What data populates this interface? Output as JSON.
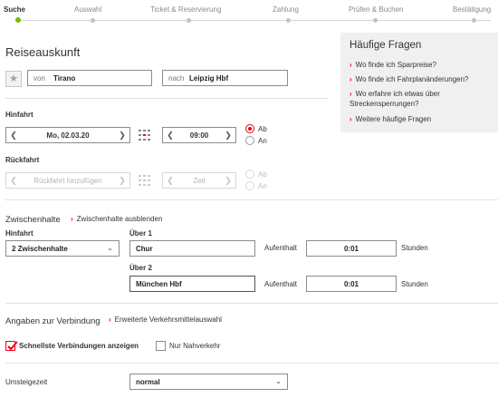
{
  "steps": [
    {
      "label": "Suche",
      "active": true
    },
    {
      "label": "Auswahl",
      "active": false
    },
    {
      "label": "Ticket & Reservierung",
      "active": false
    },
    {
      "label": "Zahlung",
      "active": false
    },
    {
      "label": "Prüfen & Buchen",
      "active": false
    },
    {
      "label": "Bestätigung",
      "active": false
    }
  ],
  "title": "Reiseauskunft",
  "route": {
    "from_label": "von",
    "from_value": "Tirano",
    "to_label": "nach",
    "to_value": "Leipzig Hbf"
  },
  "hinfahrt": {
    "heading": "Hinfahrt",
    "date": "Mo, 02.03.20",
    "time": "09:00",
    "ab": "Ab",
    "an": "An"
  },
  "rueckfahrt": {
    "heading": "Rückfahrt",
    "date_placeholder": "Rückfahrt hinzufügen",
    "time_placeholder": "Zeit",
    "ab": "Ab",
    "an": "An"
  },
  "zwischenhalte": {
    "heading": "Zwischenhalte",
    "toggle_link": "Zwischenhalte ausblenden",
    "hinfahrt_label": "Hinfahrt",
    "select_value": "2 Zwischenhalte",
    "stops": [
      {
        "label": "Über 1",
        "value": "Chur",
        "aufenthalt_label": "Aufenthalt",
        "aufenthalt_value": "0:01",
        "unit": "Stunden"
      },
      {
        "label": "Über 2",
        "value": "München Hbf",
        "aufenthalt_label": "Aufenthalt",
        "aufenthalt_value": "0:01",
        "unit": "Stunden"
      }
    ]
  },
  "verbindung": {
    "heading": "Angaben zur Verbindung",
    "link": "Erweiterte Verkehrsmittelauswahl",
    "fastest_label": "Schnellste Verbindungen anzeigen",
    "fastest_checked": true,
    "local_label": "Nur Nahverkehr",
    "local_checked": false
  },
  "umsteigezeit": {
    "label": "Umsteigezeit",
    "value": "normal"
  },
  "faq": {
    "title": "Häufige Fragen",
    "items": [
      "Wo finde ich Sparpreise?",
      "Wo finde ich Fahrplanänderungen?",
      "Wo erfahre ich etwas über Streckensperrungen?",
      "Weitere häufige Fragen"
    ]
  },
  "colors": {
    "accent": "#ec0016",
    "progress": "#7ab800"
  }
}
